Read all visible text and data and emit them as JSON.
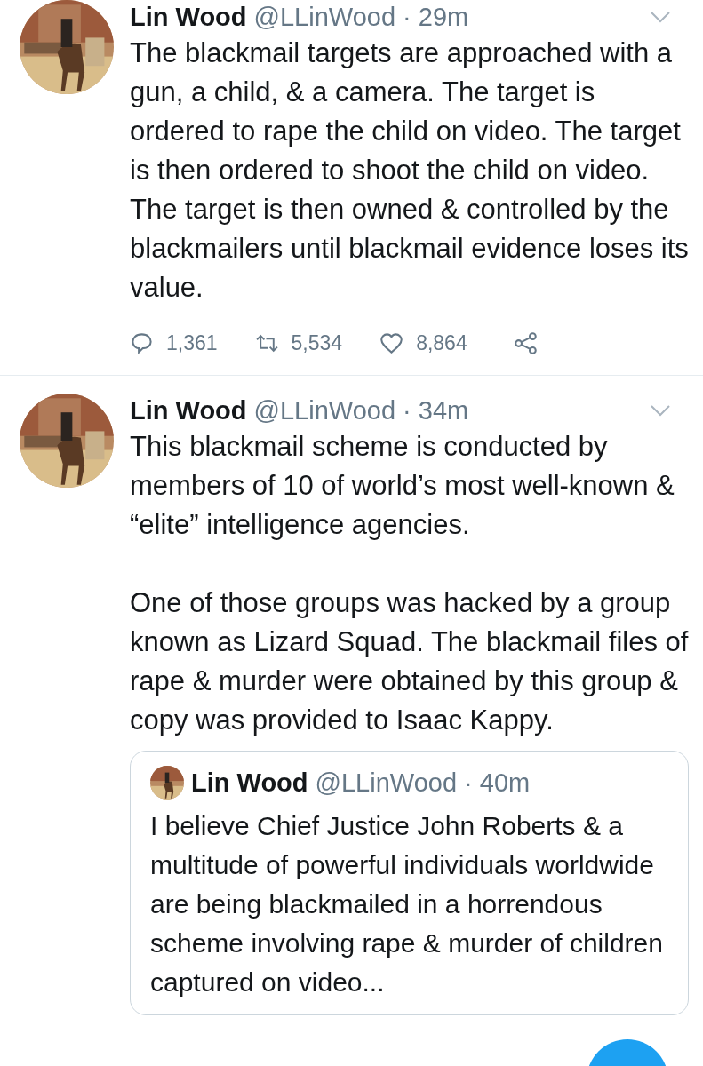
{
  "tweets": [
    {
      "name": "Lin Wood",
      "handle": "@LLinWood",
      "time": "· 29m",
      "paragraphs": [
        "The blackmail targets are approached with a gun, a child, & a camera. The target is ordered to rape the child on video. The target is then ordered to shoot the child on video. The target is then owned & controlled by the blackmailers until blackmail evidence loses its value."
      ],
      "actions": {
        "replies": "1,361",
        "retweets": "5,534",
        "likes": "8,864"
      }
    },
    {
      "name": "Lin Wood",
      "handle": "@LLinWood",
      "time": "· 34m",
      "paragraphs": [
        "This blackmail scheme is conducted by members of 10 of world’s most well-known & “elite” intelligence agencies.",
        "One of those groups was hacked by a group known as Lizard Squad. The blackmail files of rape & murder were obtained by this group & copy was provided to Isaac Kappy."
      ],
      "quote": {
        "name": "Lin Wood",
        "handle": "@LLinWood",
        "time": "· 40m",
        "text": "I believe Chief Justice John Roberts & a multitude of powerful individuals worldwide are being blackmailed in a horrendous scheme involving rape & murder of children captured on video..."
      }
    }
  ]
}
